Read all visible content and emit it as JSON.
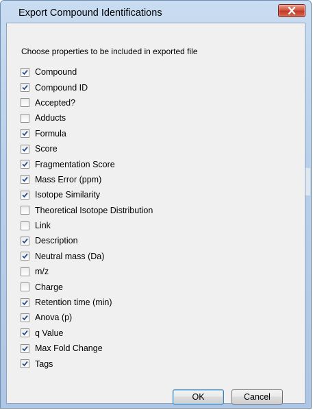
{
  "window": {
    "title": "Export Compound Identifications"
  },
  "instruction": "Choose properties to be included in exported file",
  "properties": [
    {
      "label": "Compound",
      "checked": true
    },
    {
      "label": "Compound ID",
      "checked": true
    },
    {
      "label": "Accepted?",
      "checked": false
    },
    {
      "label": "Adducts",
      "checked": false
    },
    {
      "label": "Formula",
      "checked": true
    },
    {
      "label": "Score",
      "checked": true
    },
    {
      "label": "Fragmentation Score",
      "checked": true
    },
    {
      "label": "Mass Error (ppm)",
      "checked": true
    },
    {
      "label": "Isotope Similarity",
      "checked": true
    },
    {
      "label": "Theoretical Isotope Distribution",
      "checked": false
    },
    {
      "label": "Link",
      "checked": false
    },
    {
      "label": "Description",
      "checked": true
    },
    {
      "label": "Neutral mass (Da)",
      "checked": true
    },
    {
      "label": "m/z",
      "checked": false
    },
    {
      "label": "Charge",
      "checked": false
    },
    {
      "label": "Retention time (min)",
      "checked": true
    },
    {
      "label": "Anova (p)",
      "checked": true
    },
    {
      "label": "q Value",
      "checked": true
    },
    {
      "label": "Max Fold Change",
      "checked": true
    },
    {
      "label": "Tags",
      "checked": true
    }
  ],
  "buttons": {
    "ok": "OK",
    "cancel": "Cancel"
  },
  "icons": {
    "close": "close-icon",
    "check": "checkmark-icon"
  },
  "colors": {
    "titlebar": "#b9d0ea",
    "close_button": "#c0392b",
    "check": "#2a4e8a",
    "client": "#f0f0f0"
  }
}
